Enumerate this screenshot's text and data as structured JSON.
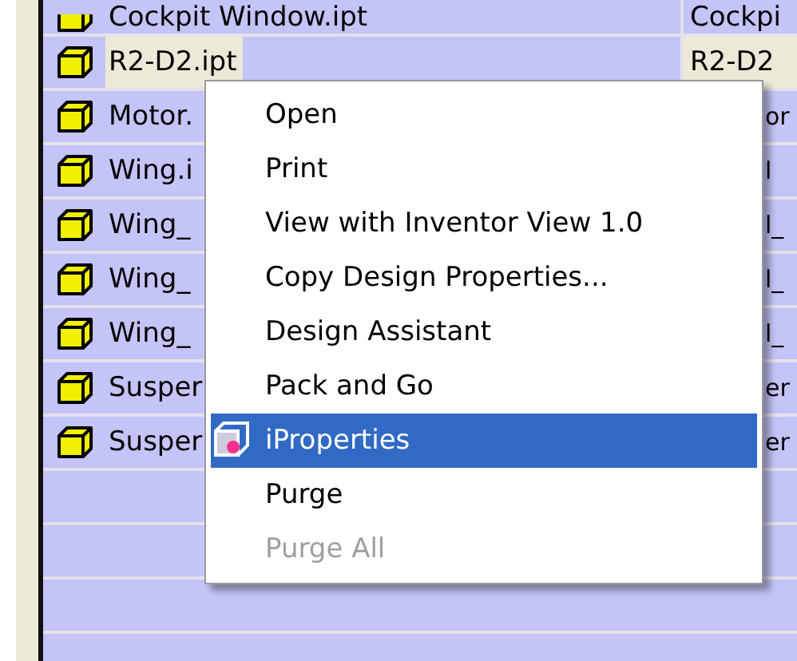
{
  "file_list": {
    "rows": [
      {
        "name": "Cockpit Window.ipt",
        "column_2": "Cockpi",
        "selected": false
      },
      {
        "name": "R2-D2.ipt",
        "column_2": "R2-D2",
        "selected": true
      },
      {
        "name": "Motor.",
        "column_2": "or",
        "selected": false
      },
      {
        "name": "Wing.i",
        "column_2": "l",
        "selected": false
      },
      {
        "name": "Wing_",
        "column_2": "l_",
        "selected": false
      },
      {
        "name": "Wing_",
        "column_2": "l_",
        "selected": false
      },
      {
        "name": "Wing_",
        "column_2": "l_",
        "selected": false
      },
      {
        "name": "Susper",
        "column_2": "er",
        "selected": false
      },
      {
        "name": "Susper",
        "column_2": "er",
        "selected": false
      }
    ]
  },
  "context_menu": {
    "items": [
      {
        "label": "Open",
        "selected": false,
        "disabled": false,
        "has_icon": false
      },
      {
        "label": "Print",
        "selected": false,
        "disabled": false,
        "has_icon": false
      },
      {
        "label": "View with Inventor View 1.0",
        "selected": false,
        "disabled": false,
        "has_icon": false
      },
      {
        "label": "Copy Design Properties...",
        "selected": false,
        "disabled": false,
        "has_icon": false
      },
      {
        "label": "Design Assistant",
        "selected": false,
        "disabled": false,
        "has_icon": false
      },
      {
        "label": "Pack and Go",
        "selected": false,
        "disabled": false,
        "has_icon": false
      },
      {
        "label": "iProperties",
        "selected": true,
        "disabled": false,
        "has_icon": true
      },
      {
        "label": "Purge",
        "selected": false,
        "disabled": false,
        "has_icon": false
      },
      {
        "label": "Purge All",
        "selected": false,
        "disabled": true,
        "has_icon": false
      }
    ]
  }
}
